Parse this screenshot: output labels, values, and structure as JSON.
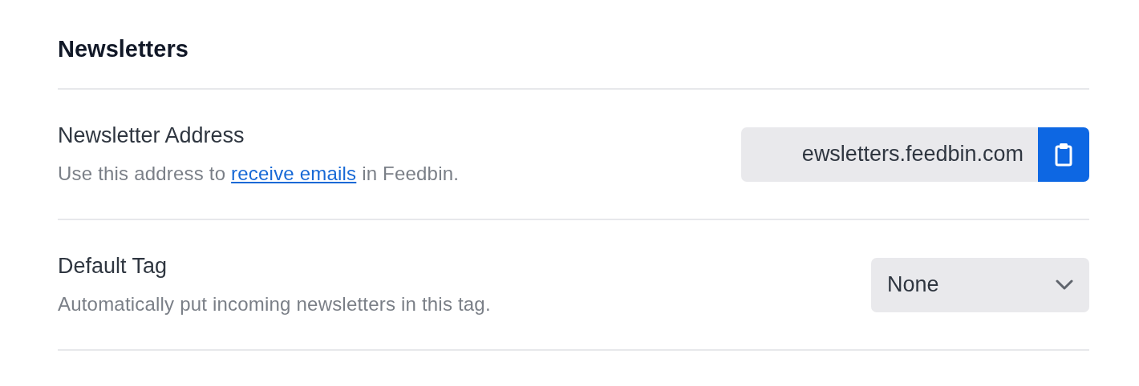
{
  "section": {
    "title": "Newsletters"
  },
  "rows": [
    {
      "kind": "copy",
      "label": "Newsletter Address",
      "description": {
        "before": "Use this address to ",
        "link": "receive emails",
        "after": " in Feedbin."
      },
      "value": "ewsletters.feedbin.com"
    },
    {
      "kind": "select",
      "label": "Default Tag",
      "description": {
        "before": "Automatically put incoming newsletters in this tag."
      },
      "value": "None"
    }
  ]
}
